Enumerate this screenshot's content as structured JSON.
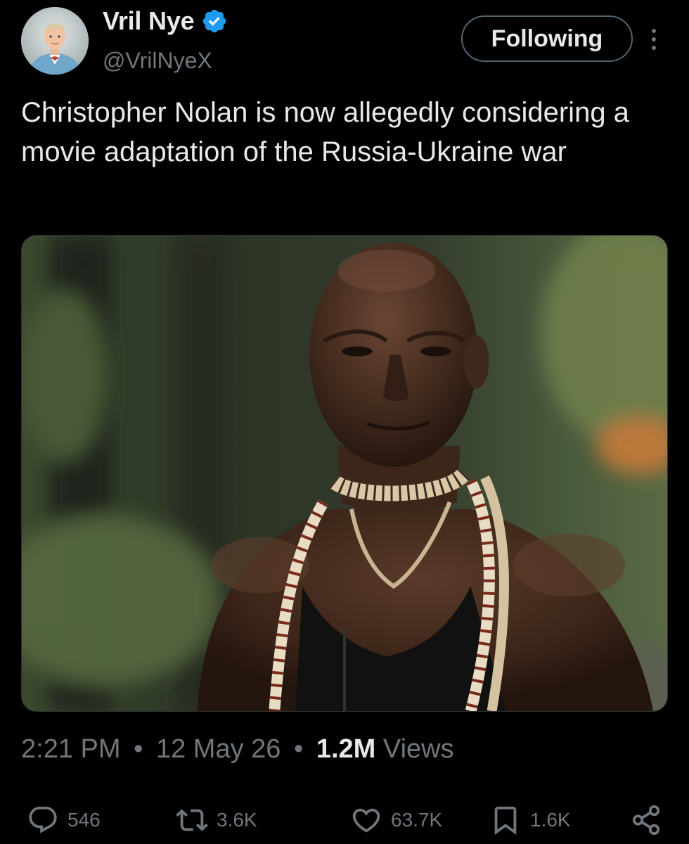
{
  "author": {
    "display_name": "Vril Nye",
    "handle": "@VrilNyeX",
    "verified": true
  },
  "follow_button": {
    "label": "Following"
  },
  "tweet": {
    "text": "Christopher Nolan is now allegedly considering a movie adaptation of the Russia-Ukraine war"
  },
  "meta": {
    "time": "2:21 PM",
    "date": "12 May 26",
    "separator": "•",
    "views_count": "1.2M",
    "views_label": "Views"
  },
  "actions": {
    "replies": "546",
    "retweets": "3.6K",
    "likes": "63.7K",
    "bookmarks": "1.6K"
  },
  "icons": {
    "verified": "verified-badge-icon",
    "more": "more-vertical-icon",
    "reply": "reply-icon",
    "retweet": "retweet-icon",
    "like": "heart-icon",
    "bookmark": "bookmark-icon",
    "share": "share-icon"
  },
  "colors": {
    "background": "#000000",
    "text_primary": "#e7e9ea",
    "text_secondary": "#71767b",
    "verified_blue": "#1d9bf0",
    "border": "#536471"
  }
}
